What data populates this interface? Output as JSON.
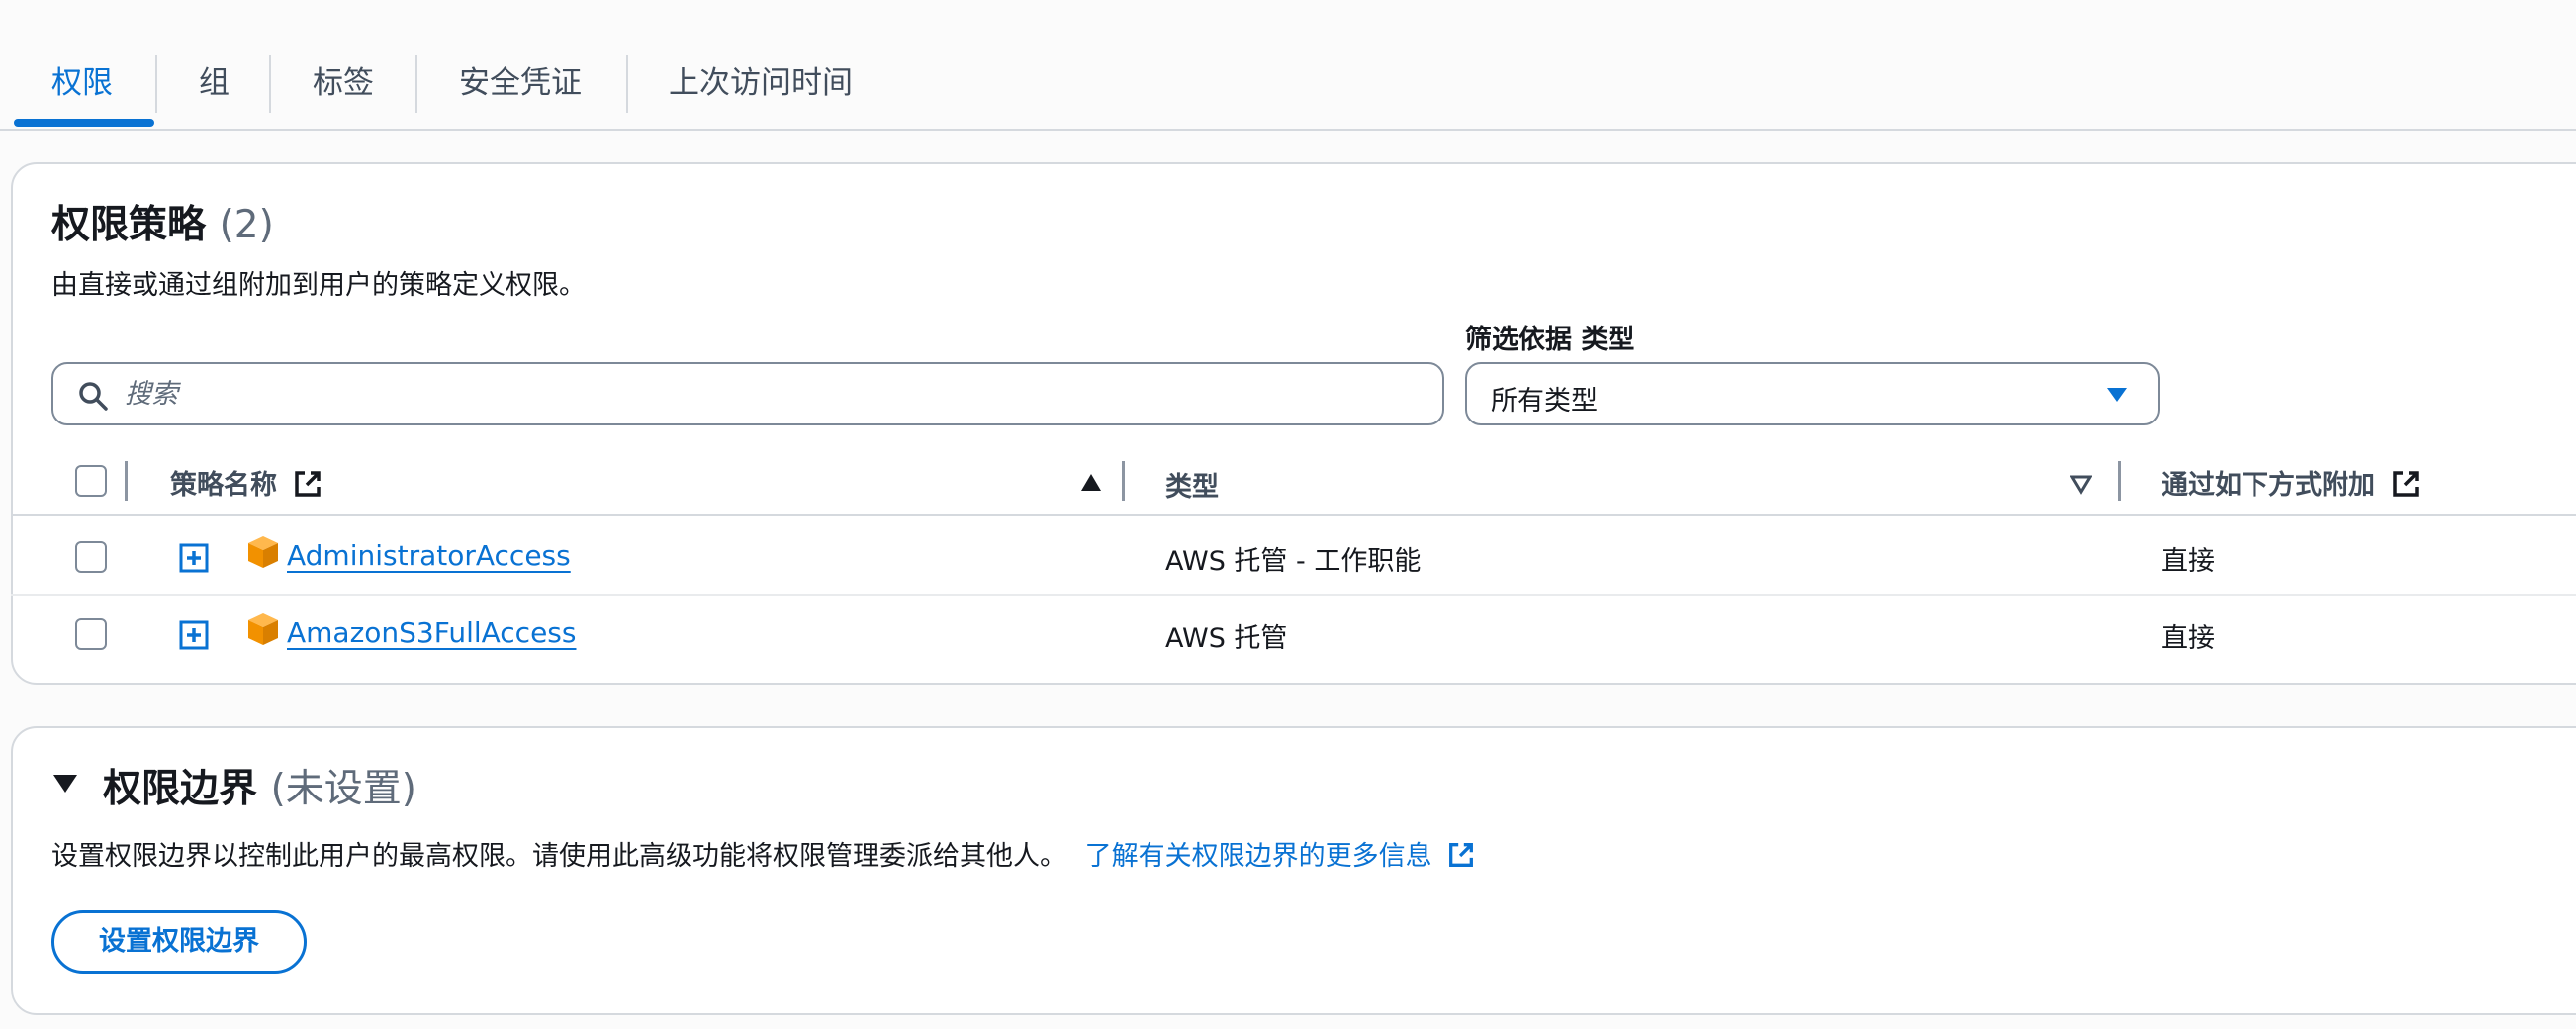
{
  "tabs": [
    {
      "label": "权限"
    },
    {
      "label": "组"
    },
    {
      "label": "标签"
    },
    {
      "label": "安全凭证"
    },
    {
      "label": "上次访问时间"
    }
  ],
  "permissions": {
    "title": "权限策略",
    "count": "(2)",
    "description": "由直接或通过组附加到用户的策略定义权限。",
    "search_placeholder": "搜索",
    "filter_label": "筛选依据 类型",
    "filter_value": "所有类型",
    "columns": [
      "策略名称",
      "类型",
      "通过如下方式附加"
    ],
    "rows": [
      {
        "name": "AdministratorAccess",
        "type": "AWS 托管 - 工作职能",
        "attached": "直接"
      },
      {
        "name": "AmazonS3FullAccess",
        "type": "AWS 托管",
        "attached": "直接"
      }
    ]
  },
  "boundary": {
    "title": "权限边界",
    "status": "(未设置)",
    "description": "设置权限边界以控制此用户的最高权限。请使用此高级功能将权限管理委派给其他人。",
    "learn_more": "了解有关权限边界的更多信息",
    "button_label": "设置权限边界"
  },
  "colors": {
    "accent": "#0972d3",
    "text": "#16191f",
    "muted": "#5f6b7a",
    "border": "#d5d9de",
    "aws_orange": "#f29100"
  }
}
